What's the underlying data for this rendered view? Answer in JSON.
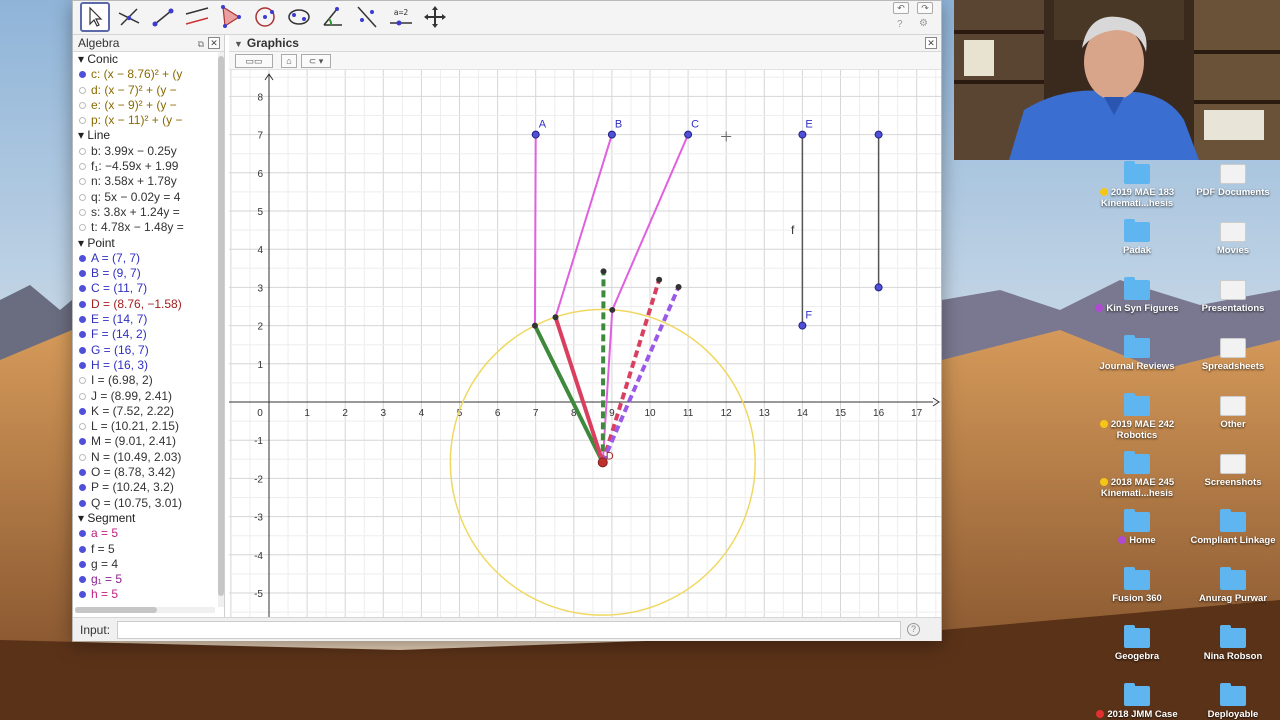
{
  "colors": {
    "accent_point": "#4f4fd8",
    "conic": "#f0d860",
    "pink_segment": "#e060e0",
    "green_segment": "#3d8a3d",
    "red_segment": "#d94060",
    "purple_dashed": "#9b59e8"
  },
  "toolbar": {
    "tools": [
      "move-tool",
      "line-tool",
      "segment-tool",
      "parallel-line-tool",
      "polygon-tool",
      "circle-tool",
      "conic-tool",
      "angle-tool",
      "reflect-tool",
      "slider-tool",
      "move-view-tool"
    ],
    "slider_label": "a=2"
  },
  "algebra": {
    "title": "Algebra",
    "categories": [
      {
        "name": "Conic",
        "items": [
          {
            "text": "c: (x − 8.76)² + (y",
            "shown": true,
            "color": "#8a6a00"
          },
          {
            "text": "d: (x − 7)² + (y −",
            "shown": false,
            "color": "#8a6a00"
          },
          {
            "text": "e: (x − 9)² + (y −",
            "shown": false,
            "color": "#8a6a00"
          },
          {
            "text": "p: (x − 11)² + (y −",
            "shown": false,
            "color": "#8a6a00"
          }
        ]
      },
      {
        "name": "Line",
        "items": [
          {
            "text": "b: 3.99x − 0.25y",
            "shown": false,
            "color": "#333333"
          },
          {
            "text": "f₁: −4.59x + 1.99",
            "shown": false,
            "color": "#333333"
          },
          {
            "text": "n: 3.58x + 1.78y",
            "shown": false,
            "color": "#333333"
          },
          {
            "text": "q: 5x − 0.02y = 4",
            "shown": false,
            "color": "#333333"
          },
          {
            "text": "s: 3.8x + 1.24y =",
            "shown": false,
            "color": "#333333"
          },
          {
            "text": "t: 4.78x − 1.48y =",
            "shown": false,
            "color": "#333333"
          }
        ]
      },
      {
        "name": "Point",
        "items": [
          {
            "text": "A = (7, 7)",
            "shown": true,
            "color": "#3030c0"
          },
          {
            "text": "B = (9, 7)",
            "shown": true,
            "color": "#3030c0"
          },
          {
            "text": "C = (11, 7)",
            "shown": true,
            "color": "#3030c0"
          },
          {
            "text": "D = (8.76, −1.58)",
            "shown": true,
            "color": "#a02020"
          },
          {
            "text": "E = (14, 7)",
            "shown": true,
            "color": "#3030c0"
          },
          {
            "text": "F = (14, 2)",
            "shown": true,
            "color": "#3030c0"
          },
          {
            "text": "G = (16, 7)",
            "shown": true,
            "color": "#3030c0"
          },
          {
            "text": "H = (16, 3)",
            "shown": true,
            "color": "#3030c0"
          },
          {
            "text": "I = (6.98, 2)",
            "shown": false,
            "color": "#333333"
          },
          {
            "text": "J = (8.99, 2.41)",
            "shown": false,
            "color": "#333333"
          },
          {
            "text": "K = (7.52, 2.22)",
            "shown": true,
            "color": "#333333"
          },
          {
            "text": "L = (10.21, 2.15)",
            "shown": false,
            "color": "#333333"
          },
          {
            "text": "M = (9.01, 2.41)",
            "shown": true,
            "color": "#333333"
          },
          {
            "text": "N = (10.49, 2.03)",
            "shown": false,
            "color": "#333333"
          },
          {
            "text": "O = (8.78, 3.42)",
            "shown": true,
            "color": "#333333"
          },
          {
            "text": "P = (10.24, 3.2)",
            "shown": true,
            "color": "#333333"
          },
          {
            "text": "Q = (10.75, 3.01)",
            "shown": true,
            "color": "#333333"
          }
        ]
      },
      {
        "name": "Segment",
        "items": [
          {
            "text": "a = 5",
            "shown": true,
            "color": "#c02080"
          },
          {
            "text": "f = 5",
            "shown": true,
            "color": "#333333"
          },
          {
            "text": "g = 4",
            "shown": true,
            "color": "#333333"
          },
          {
            "text": "g₁ = 5",
            "shown": true,
            "color": "#8a2090"
          },
          {
            "text": "h = 5",
            "shown": true,
            "color": "#c02080"
          }
        ]
      }
    ]
  },
  "graphics": {
    "title": "Graphics",
    "x_range": [
      0,
      17
    ],
    "y_range": [
      -5,
      8
    ],
    "x_ticks": [
      "0",
      "1",
      "2",
      "3",
      "4",
      "5",
      "6",
      "7",
      "8",
      "9",
      "10",
      "11",
      "12",
      "13",
      "14",
      "15",
      "16",
      "17"
    ],
    "y_ticks": [
      "-5",
      "-4",
      "-3",
      "-2",
      "-1",
      "1",
      "2",
      "3",
      "4",
      "5",
      "6",
      "7",
      "8"
    ],
    "circle": {
      "cx": 8.76,
      "cy": -1.58,
      "r": 4
    },
    "points": [
      {
        "name": "A",
        "x": 7,
        "y": 7,
        "label": "A"
      },
      {
        "name": "B",
        "x": 9,
        "y": 7,
        "label": "B"
      },
      {
        "name": "C",
        "x": 11,
        "y": 7,
        "label": "C"
      },
      {
        "name": "E",
        "x": 14,
        "y": 7,
        "label": "E"
      },
      {
        "name": "F",
        "x": 14,
        "y": 2,
        "label": "F"
      },
      {
        "name": "G",
        "x": 16,
        "y": 7,
        "label": ""
      },
      {
        "name": "H",
        "x": 16,
        "y": 3,
        "label": ""
      },
      {
        "name": "D",
        "x": 8.76,
        "y": -1.58,
        "label": "D"
      }
    ],
    "segment_label": "f",
    "pink_segments": [
      {
        "x1": 7,
        "y1": 7,
        "x2": 6.98,
        "y2": 2
      },
      {
        "x1": 9,
        "y1": 7,
        "x2": 7.52,
        "y2": 2.22
      },
      {
        "x1": 11,
        "y1": 7,
        "x2": 9.01,
        "y2": 2.41
      },
      {
        "x1": 9.01,
        "y1": 2.41,
        "x2": 8.76,
        "y2": -1.58
      }
    ],
    "gray_segments": [
      {
        "x1": 14,
        "y1": 7,
        "x2": 14,
        "y2": 2
      },
      {
        "x1": 16,
        "y1": 7,
        "x2": 16,
        "y2": 3
      }
    ],
    "solid_arms": [
      {
        "x1": 8.76,
        "y1": -1.58,
        "x2": 6.98,
        "y2": 2,
        "color": "#3d8a3d"
      },
      {
        "x1": 8.76,
        "y1": -1.58,
        "x2": 7.52,
        "y2": 2.22,
        "color": "#d94060"
      }
    ],
    "dashed_arms": [
      {
        "x1": 8.76,
        "y1": -1.58,
        "x2": 8.78,
        "y2": 3.42,
        "color": "#3d8a3d"
      },
      {
        "x1": 8.76,
        "y1": -1.58,
        "x2": 10.24,
        "y2": 3.2,
        "color": "#d94060"
      },
      {
        "x1": 8.76,
        "y1": -1.58,
        "x2": 10.75,
        "y2": 3.01,
        "color": "#9b59e8"
      }
    ],
    "small_points": [
      {
        "x": 6.98,
        "y": 2
      },
      {
        "x": 7.52,
        "y": 2.22
      },
      {
        "x": 9.01,
        "y": 2.41
      },
      {
        "x": 8.78,
        "y": 3.42
      },
      {
        "x": 10.24,
        "y": 3.2
      },
      {
        "x": 10.75,
        "y": 3.01
      }
    ]
  },
  "input": {
    "label": "Input:",
    "value": ""
  },
  "desktop_icons": [
    {
      "label": "2019 MAE 183 Kinemati...hesis",
      "tag": "#f5c518",
      "kind": "folder",
      "col": 0,
      "row": 0
    },
    {
      "label": "PDF Documents",
      "tag": "",
      "kind": "file",
      "col": 1,
      "row": 0
    },
    {
      "label": "Padak",
      "tag": "",
      "kind": "folder",
      "col": 0,
      "row": 1
    },
    {
      "label": "Movies",
      "tag": "",
      "kind": "file",
      "col": 1,
      "row": 1
    },
    {
      "label": "Kin Syn Figures",
      "tag": "#b04ad0",
      "kind": "folder",
      "col": 0,
      "row": 2
    },
    {
      "label": "Presentations",
      "tag": "",
      "kind": "file",
      "col": 1,
      "row": 2
    },
    {
      "label": "Journal Reviews",
      "tag": "",
      "kind": "folder",
      "col": 0,
      "row": 3
    },
    {
      "label": "Spreadsheets",
      "tag": "",
      "kind": "file",
      "col": 1,
      "row": 3
    },
    {
      "label": "2019 MAE 242 Robotics",
      "tag": "#f5c518",
      "kind": "folder",
      "col": 0,
      "row": 4
    },
    {
      "label": "Other",
      "tag": "",
      "kind": "file",
      "col": 1,
      "row": 4
    },
    {
      "label": "2018 MAE 245 Kinemati...hesis",
      "tag": "#f5c518",
      "kind": "folder",
      "col": 0,
      "row": 5
    },
    {
      "label": "Screenshots",
      "tag": "",
      "kind": "file",
      "col": 1,
      "row": 5
    },
    {
      "label": "Home",
      "tag": "#b04ad0",
      "kind": "folder",
      "col": 0,
      "row": 6
    },
    {
      "label": "Compliant Linkage",
      "tag": "",
      "kind": "folder",
      "col": 1,
      "row": 6
    },
    {
      "label": "Fusion 360",
      "tag": "",
      "kind": "folder",
      "col": 0,
      "row": 7
    },
    {
      "label": "Anurag Purwar",
      "tag": "",
      "kind": "folder",
      "col": 1,
      "row": 7
    },
    {
      "label": "Geogebra",
      "tag": "",
      "kind": "folder",
      "col": 0,
      "row": 8
    },
    {
      "label": "Nina Robson",
      "tag": "",
      "kind": "folder",
      "col": 1,
      "row": 8
    },
    {
      "label": "2018 JMM Case",
      "tag": "#e03030",
      "kind": "folder",
      "col": 0,
      "row": 9
    },
    {
      "label": "Deployable",
      "tag": "",
      "kind": "folder",
      "col": 1,
      "row": 9
    }
  ]
}
